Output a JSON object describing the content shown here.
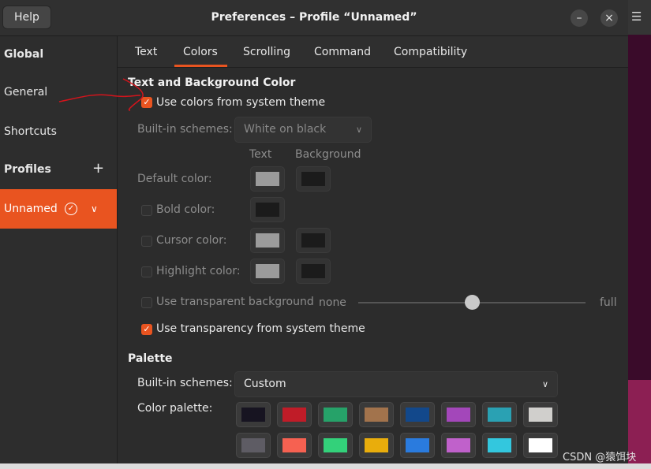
{
  "window": {
    "title": "Preferences – Profile “Unnamed”",
    "help_label": "Help",
    "minimize_glyph": "–",
    "close_glyph": "×"
  },
  "sidebar": {
    "global_header": "Global",
    "general": "General",
    "shortcuts": "Shortcuts",
    "profiles_header": "Profiles",
    "add_glyph": "+",
    "selected_profile": "Unnamed"
  },
  "tabs": [
    "Text",
    "Colors",
    "Scrolling",
    "Command",
    "Compatibility"
  ],
  "active_tab": "Colors",
  "colors_tab": {
    "text_bg_section": "Text and Background Color",
    "use_system_colors": "Use colors from system theme",
    "use_system_colors_checked": true,
    "builtin_schemes_label": "Built-in schemes:",
    "builtin_schemes_value": "White on black",
    "col_text": "Text",
    "col_background": "Background",
    "default_color": "Default color:",
    "bold_color": "Bold color:",
    "cursor_color": "Cursor color:",
    "highlight_color": "Highlight color:",
    "transparent_bg": "Use transparent background",
    "slider_none": "none",
    "slider_full": "full",
    "transparency_level": 0.5,
    "system_transparency": "Use transparency from system theme",
    "system_transparency_checked": true,
    "swatches": {
      "default_text": "#9b9b9b",
      "default_bg": "#1b1b1b",
      "bold": "#1b1b1b",
      "cursor_text": "#9b9b9b",
      "cursor_bg": "#1b1b1b",
      "highlight_text": "#9b9b9b",
      "highlight_bg": "#1b1b1b"
    }
  },
  "palette": {
    "section": "Palette",
    "builtin_label": "Built-in schemes:",
    "builtin_value": "Custom",
    "color_palette_label": "Color palette:",
    "row1": [
      "#171421",
      "#c01c28",
      "#26a269",
      "#a2734c",
      "#12488b",
      "#a347ba",
      "#2aa1b3",
      "#d0cfcc"
    ],
    "row2": [
      "#5e5c64",
      "#f66151",
      "#33d17a",
      "#e9ad0c",
      "#2a7bde",
      "#c061cb",
      "#33c7de",
      "#ffffff"
    ]
  },
  "accent": "#e95420",
  "watermark": "CSDN @猿饵块",
  "bg_menu_glyph": "☰"
}
